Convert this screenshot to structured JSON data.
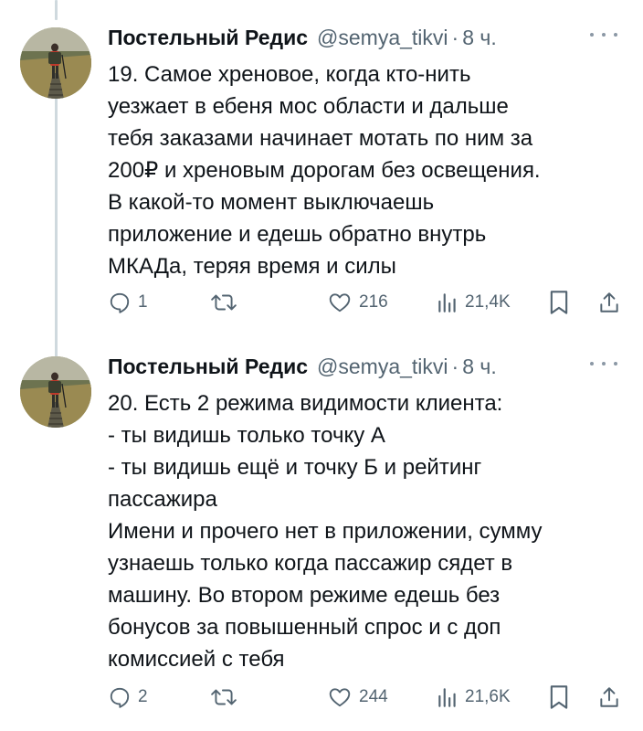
{
  "tweets": [
    {
      "author": {
        "name": "Постельный Редис",
        "handle": "@semya_tikvi",
        "avatar_icon": "hiker-photo"
      },
      "time": "8 ч.",
      "separator": "·",
      "text": "19. Самое хреновое, когда кто-нить\nуезжает в ебеня мос области и дальше\nтебя заказами начинает мотать по ним за\n200₽ и хреновым дорогам без освещения.\nВ какой-то момент выключаешь\nприложение и едешь обратно внутрь\nМКАДа, теряя время и силы",
      "stats": {
        "replies": "1",
        "retweets": "",
        "likes": "216",
        "views": "21,4K"
      }
    },
    {
      "author": {
        "name": "Постельный Редис",
        "handle": "@semya_tikvi",
        "avatar_icon": "hiker-photo"
      },
      "time": "8 ч.",
      "separator": "·",
      "text": "20. Есть 2 режима видимости клиента:\n- ты видишь только точку А\n- ты видишь ещё и точку Б и рейтинг\nпассажира\nИмени и прочего нет в приложении, сумму\nузнаешь только когда пассажир сядет в\nмашину. Во втором режиме едешь без\nбонусов за повышенный спрос и с доп\nкомиссией с тебя",
      "stats": {
        "replies": "2",
        "retweets": "",
        "likes": "244",
        "views": "21,6K"
      }
    }
  ],
  "icons": {
    "reply": "reply-icon",
    "retweet": "retweet-icon",
    "like": "heart-icon",
    "views": "views-chart-icon",
    "bookmark": "bookmark-icon",
    "share": "share-icon",
    "more": "more-dots-icon"
  },
  "colors": {
    "text": "#0f1419",
    "secondary": "#536471",
    "thread_line": "#cfd9de"
  }
}
